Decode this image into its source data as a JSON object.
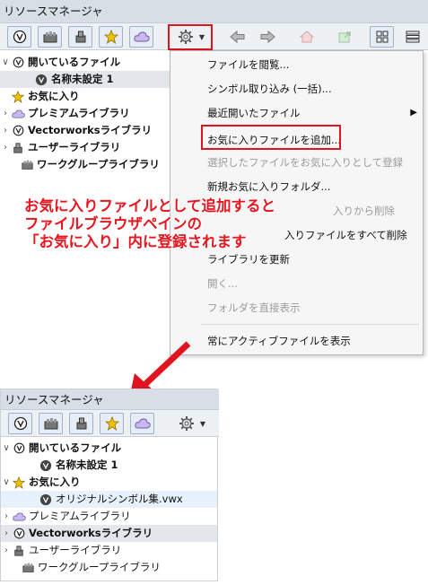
{
  "top": {
    "window_title": "リソースマネージャ",
    "tree": [
      {
        "label": "開いているファイル",
        "chevron": "∨",
        "icon": "vw-icon"
      },
      {
        "label": "名称未設定 1",
        "icon": "vw-file-icon"
      },
      {
        "label": "お気に入り",
        "icon": "star-icon"
      },
      {
        "label": "プレミアムライブラリ",
        "chevron": "›",
        "icon": "cloud-icon"
      },
      {
        "label": "Vectorworksライブラリ",
        "chevron": "›",
        "icon": "vw-icon"
      },
      {
        "label": "ユーザーライブラリ",
        "chevron": "›",
        "icon": "user-icon"
      },
      {
        "label": "ワークグループライブラリ",
        "icon": "workgroup-icon"
      }
    ]
  },
  "menu": {
    "items": [
      {
        "label": "ファイルを閲覧...",
        "disabled": false
      },
      {
        "label": "シンボル取り込み (一括)...",
        "disabled": false
      },
      {
        "label": "最近開いたファイル",
        "disabled": false,
        "submenu": "▶"
      },
      {
        "label": "お気に入りファイルを追加...",
        "disabled": false
      },
      {
        "label": "選択したファイルをお気に入りとして登録",
        "disabled": true
      },
      {
        "label": "新規お気に入りフォルダ...",
        "disabled": false
      },
      {
        "label": "入りから削除",
        "disabled": true
      },
      {
        "label": "入りファイルをすべて削除",
        "disabled": false
      },
      {
        "label": "ライブラリを更新",
        "disabled": false
      },
      {
        "label": "開く...",
        "disabled": true
      },
      {
        "label": "フォルダを直接表示",
        "disabled": true
      },
      {
        "label": "常にアクティブファイルを表示",
        "disabled": false
      }
    ]
  },
  "annotation": {
    "line1": "お気に入りファイルとして追加すると",
    "line2": "ファイルブラウザペインの",
    "line3": "「お気に入り」内に登録されます"
  },
  "bottom": {
    "window_title": "リソースマネージャ",
    "tree": [
      {
        "label": "開いているファイル",
        "chevron": "∨",
        "icon": "vw-icon"
      },
      {
        "label": "名称未設定 1",
        "icon": "vw-file-icon"
      },
      {
        "label": "お気に入り",
        "chevron": "∨",
        "icon": "star-icon"
      },
      {
        "label": "オリジナルシンボル集.vwx",
        "icon": "vw-file-icon"
      },
      {
        "label": "プレミアムライブラリ",
        "chevron": "›",
        "icon": "cloud-icon"
      },
      {
        "label": "Vectorworksライブラリ",
        "chevron": "›",
        "icon": "vw-icon"
      },
      {
        "label": "ユーザーライブラリ",
        "chevron": "›",
        "icon": "user-icon"
      },
      {
        "label": "ワークグループライブラリ",
        "icon": "workgroup-icon"
      }
    ]
  },
  "colors": {
    "accent_red": "#e0141e",
    "selection_blue": "#e6f1fb",
    "star_yellow": "#f2c200",
    "cloud_purple": "#b9a6e8"
  }
}
